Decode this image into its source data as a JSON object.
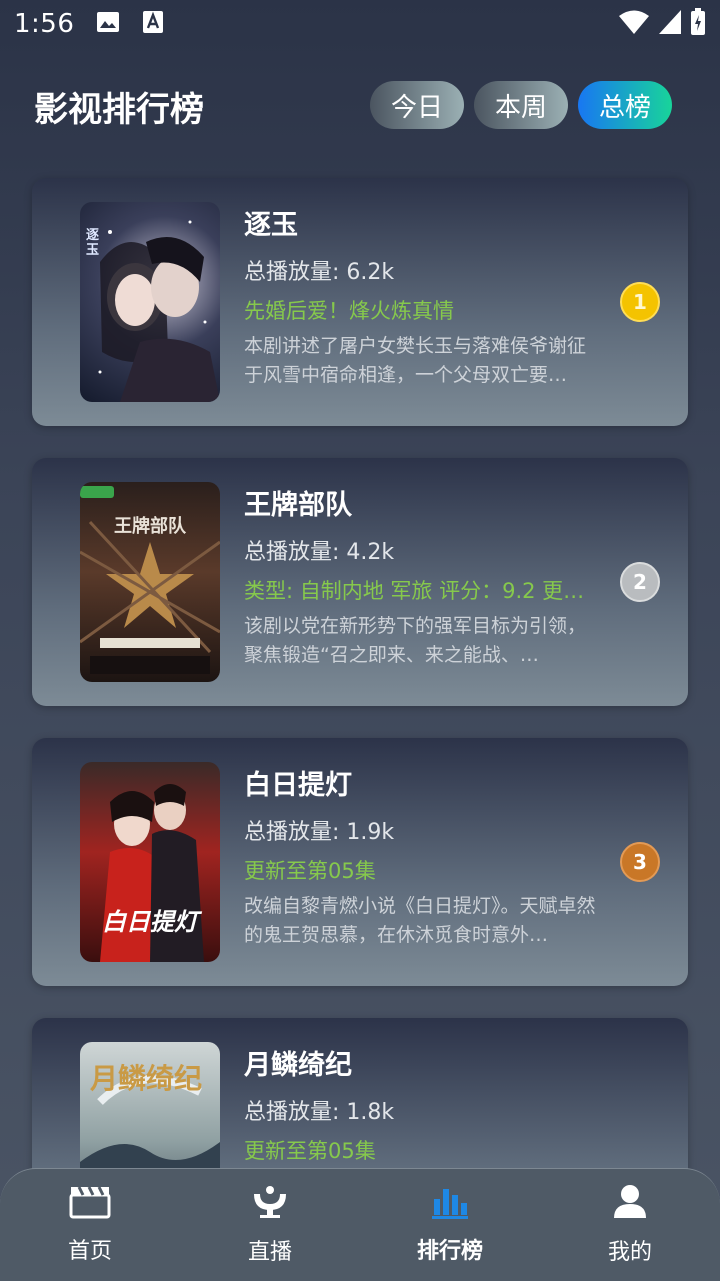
{
  "status": {
    "time": "1:56"
  },
  "header": {
    "title": "影视排行榜",
    "tabs": [
      {
        "label": "今日",
        "active": false
      },
      {
        "label": "本周",
        "active": false
      },
      {
        "label": "总榜",
        "active": true
      }
    ]
  },
  "list": [
    {
      "name": "逐玉",
      "plays": "总播放量: 6.2k",
      "tagline": "先婚后爱！烽火炼真情",
      "desc": "本剧讲述了屠户女樊长玉与落难侯爷谢征于风雪中宿命相逢，一个父母双亡要…",
      "rank": "1",
      "poster_text": "逐玉"
    },
    {
      "name": "王牌部队",
      "plays": "总播放量: 4.2k",
      "tagline": "类型: 自制内地  军旅  评分：9.2 更…",
      "desc": "该剧以党在新形势下的强军目标为引领，聚焦锻造“召之即来、来之能战、…",
      "rank": "2",
      "poster_text": "王牌部队"
    },
    {
      "name": "白日提灯",
      "plays": "总播放量: 1.9k",
      "tagline": "更新至第05集",
      "desc": "改编自黎青燃小说《白日提灯》。天赋卓然的鬼王贺思慕，在休沐觅食时意外…",
      "rank": "3",
      "poster_text": "白日提灯"
    },
    {
      "name": "月鳞绮纪",
      "plays": "总播放量: 1.8k",
      "tagline": "更新至第05集",
      "desc": "",
      "rank": "",
      "poster_text": "月鳞绮纪"
    }
  ],
  "nav": [
    {
      "label": "首页",
      "icon": "clapperboard-icon",
      "active": false
    },
    {
      "label": "直播",
      "icon": "live-broadcast-icon",
      "active": false
    },
    {
      "label": "排行榜",
      "icon": "bar-chart-icon",
      "active": true
    },
    {
      "label": "我的",
      "icon": "person-icon",
      "active": false
    }
  ],
  "colors": {
    "accent_blue": "#1e88e5",
    "tagline_green": "#86c94c",
    "gold": "#f4c300",
    "silver": "#b9bcbf",
    "bronze": "#c97727"
  }
}
